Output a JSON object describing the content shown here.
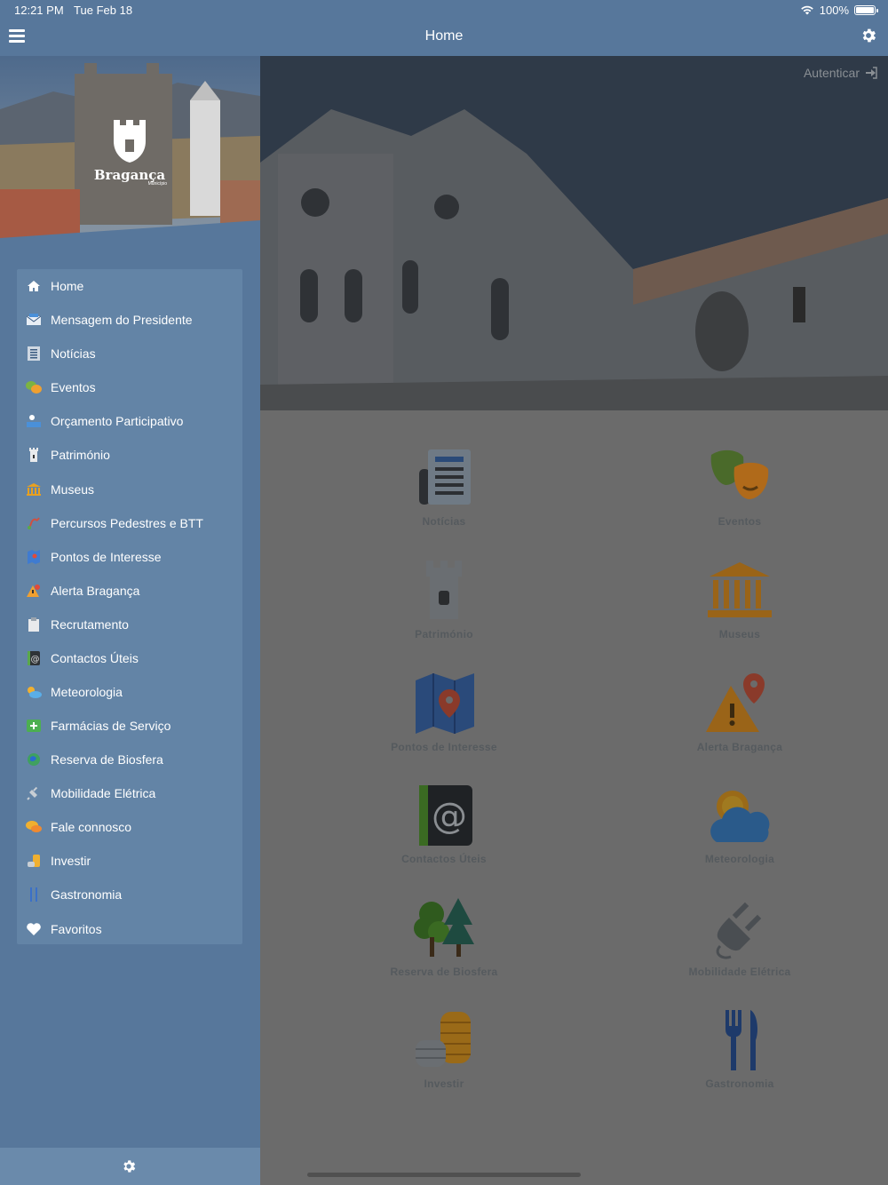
{
  "status_bar": {
    "time": "12:21 PM",
    "date": "Tue Feb 18",
    "battery": "100%"
  },
  "header": {
    "title": "Home"
  },
  "brand": {
    "name": "Bragança",
    "sub": "Município"
  },
  "auth": {
    "label": "Autenticar"
  },
  "sidebar": {
    "items": [
      {
        "label": "Home",
        "icon": "house-icon"
      },
      {
        "label": "Mensagem do Presidente",
        "icon": "envelope-icon"
      },
      {
        "label": "Notícias",
        "icon": "newspaper-icon"
      },
      {
        "label": "Eventos",
        "icon": "theater-masks-icon"
      },
      {
        "label": "Orçamento Participativo",
        "icon": "participatory-budget-icon"
      },
      {
        "label": "Património",
        "icon": "tower-icon"
      },
      {
        "label": "Museus",
        "icon": "museum-icon"
      },
      {
        "label": "Percursos Pedestres e BTT",
        "icon": "trail-icon"
      },
      {
        "label": "Pontos de Interesse",
        "icon": "map-pin-icon"
      },
      {
        "label": "Alerta Bragança",
        "icon": "alert-icon"
      },
      {
        "label": "Recrutamento",
        "icon": "clipboard-icon"
      },
      {
        "label": "Contactos Úteis",
        "icon": "contacts-icon"
      },
      {
        "label": "Meteorologia",
        "icon": "weather-icon"
      },
      {
        "label": "Farmácias de Serviço",
        "icon": "pharmacy-icon"
      },
      {
        "label": "Reserva de Biosfera",
        "icon": "biosphere-icon"
      },
      {
        "label": "Mobilidade Elétrica",
        "icon": "plug-icon"
      },
      {
        "label": "Fale connosco",
        "icon": "chat-icon"
      },
      {
        "label": "Investir",
        "icon": "coins-icon"
      },
      {
        "label": "Gastronomia",
        "icon": "cutlery-icon"
      },
      {
        "label": "Favoritos",
        "icon": "heart-icon"
      }
    ]
  },
  "tiles": [
    {
      "label": "Notícias",
      "icon": "newspaper-icon"
    },
    {
      "label": "Eventos",
      "icon": "theater-masks-icon"
    },
    {
      "label": "Património",
      "icon": "tower-icon"
    },
    {
      "label": "Museus",
      "icon": "museum-icon"
    },
    {
      "label": "Pontos de Interesse",
      "icon": "map-pin-icon"
    },
    {
      "label": "Alerta Bragança",
      "icon": "alert-icon"
    },
    {
      "label": "Contactos Úteis",
      "icon": "contacts-icon"
    },
    {
      "label": "Meteorologia",
      "icon": "weather-icon"
    },
    {
      "label": "Reserva de Biosfera",
      "icon": "trees-icon"
    },
    {
      "label": "Mobilidade Elétrica",
      "icon": "plug-icon"
    },
    {
      "label": "Investir",
      "icon": "coins-icon"
    },
    {
      "label": "Gastronomia",
      "icon": "cutlery-icon"
    }
  ],
  "colors": {
    "bar": "#57779b",
    "menu_panel": "#6384a6",
    "overlay": "#6b6b6b"
  }
}
